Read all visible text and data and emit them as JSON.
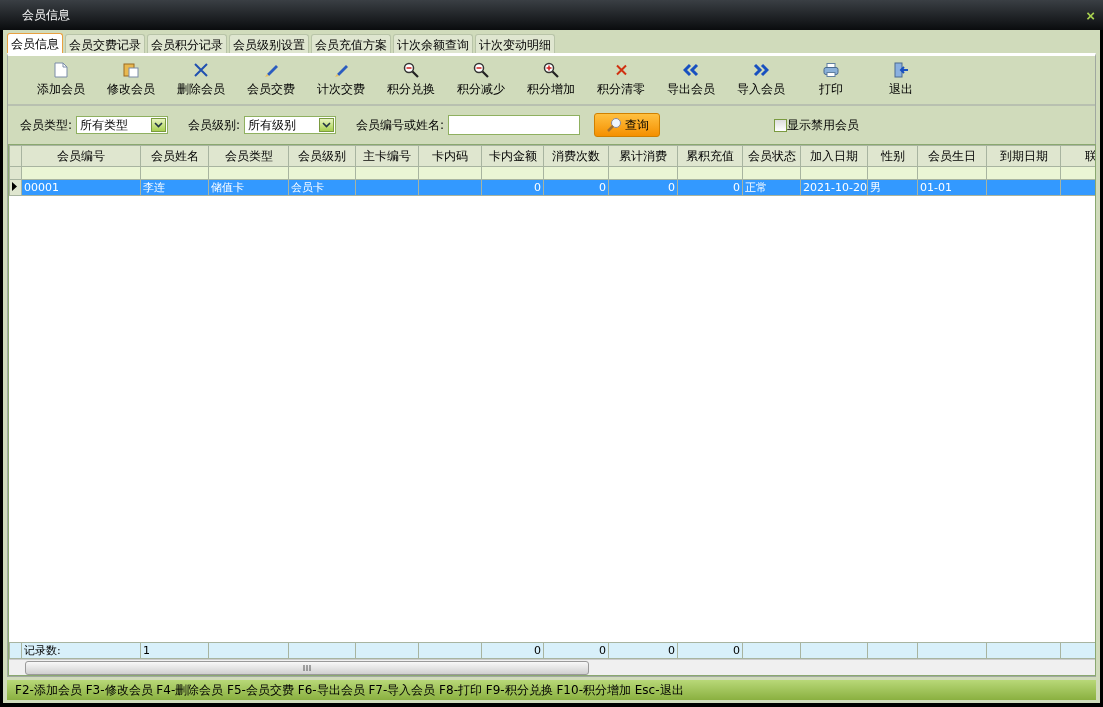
{
  "window": {
    "title": "会员信息",
    "close": "×"
  },
  "tabs": [
    {
      "label": "会员信息",
      "selected": true
    },
    {
      "label": "会员交费记录",
      "selected": false
    },
    {
      "label": "会员积分记录",
      "selected": false
    },
    {
      "label": "会员级别设置",
      "selected": false
    },
    {
      "label": "会员充值方案",
      "selected": false
    },
    {
      "label": "计次余额查询",
      "selected": false
    },
    {
      "label": "计次变动明细",
      "selected": false
    }
  ],
  "toolbar": [
    {
      "label": "添加会员",
      "kind": "document"
    },
    {
      "label": "修改会员",
      "kind": "clipboard"
    },
    {
      "label": "删除会员",
      "kind": "cross"
    },
    {
      "label": "会员交费",
      "kind": "pen"
    },
    {
      "label": "计次交费",
      "kind": "pen"
    },
    {
      "label": "积分兑换",
      "kind": "zoom-out"
    },
    {
      "label": "积分减少",
      "kind": "zoom-out"
    },
    {
      "label": "积分增加",
      "kind": "zoom-in"
    },
    {
      "label": "积分清零",
      "kind": "clear"
    },
    {
      "label": "导出会员",
      "kind": "double-left"
    },
    {
      "label": "导入会员",
      "kind": "double-right"
    },
    {
      "label": "打印",
      "kind": "printer"
    },
    {
      "label": "退出",
      "kind": "exit"
    }
  ],
  "filters": {
    "type_label": "会员类型:",
    "type_value": "所有类型",
    "level_label": "会员级别:",
    "level_value": "所有级别",
    "search_label": "会员编号或姓名:",
    "search_button": "查询",
    "show_disabled": {
      "label": "显示禁用会员",
      "checked": false
    }
  },
  "table": {
    "columns": [
      {
        "label": "会员编号",
        "kind": "text"
      },
      {
        "label": "会员姓名",
        "kind": "text"
      },
      {
        "label": "会员类型",
        "kind": "text"
      },
      {
        "label": "会员级别",
        "kind": "text"
      },
      {
        "label": "主卡编号",
        "kind": "text"
      },
      {
        "label": "卡内码",
        "kind": "text"
      },
      {
        "label": "卡内金额",
        "kind": "number",
        "total": "0"
      },
      {
        "label": "消费次数",
        "kind": "number",
        "total": "0"
      },
      {
        "label": "累计消费",
        "kind": "number",
        "total": "0"
      },
      {
        "label": "累积充值",
        "kind": "number",
        "total": "0"
      },
      {
        "label": "会员状态",
        "kind": "text"
      },
      {
        "label": "加入日期",
        "kind": "text"
      },
      {
        "label": "性别",
        "kind": "text"
      },
      {
        "label": "会员生日",
        "kind": "text"
      },
      {
        "label": "到期日期",
        "kind": "text"
      },
      {
        "label": "联",
        "kind": "text"
      }
    ],
    "rows": [
      {
        "selected": true,
        "cells": [
          {
            "text": "00001"
          },
          {
            "text": "李连"
          },
          {
            "text": "储值卡"
          },
          {
            "text": "会员卡"
          },
          {},
          {},
          {
            "text": "0"
          },
          {
            "text": "0"
          },
          {
            "text": "0"
          },
          {
            "text": "0"
          },
          {
            "text": "正常"
          },
          {
            "text": "2021-10-20"
          },
          {
            "text": "男"
          },
          {
            "text": "01-01"
          },
          {},
          {}
        ]
      }
    ],
    "summary": {
      "label": "记录数:",
      "count": "1"
    }
  },
  "status_bar": "F2-添加会员 F3-修改会员 F4-删除会员 F5-会员交费 F6-导出会员 F7-导入会员 F8-打印 F9-积分兑换 F10-积分增加 Esc-退出"
}
